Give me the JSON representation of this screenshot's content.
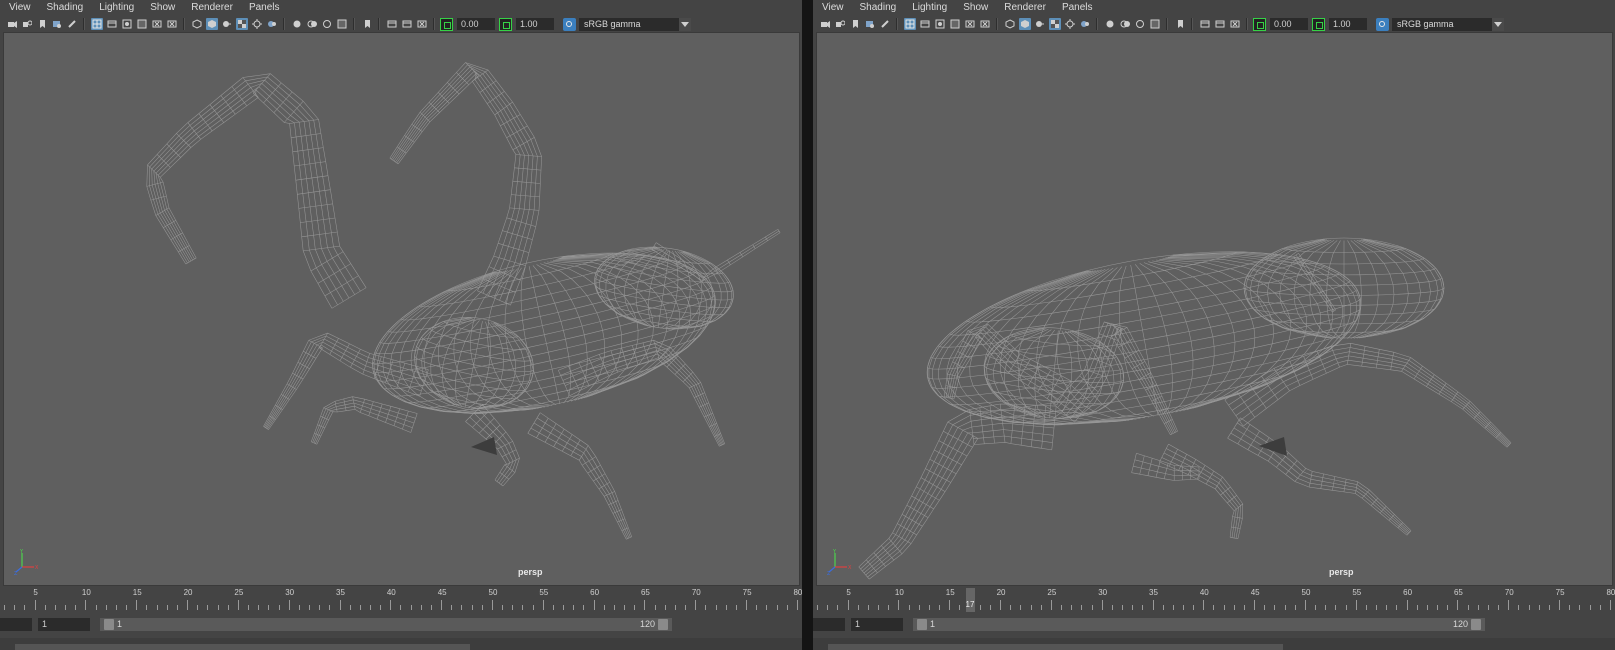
{
  "panels": [
    {
      "id": "left",
      "menu": [
        "View",
        "Shading",
        "Lighting",
        "Show",
        "Renderer",
        "Panels"
      ],
      "toolbar": {
        "exposure": "0.00",
        "gamma": "1.00",
        "color_space": "sRGB gamma"
      },
      "camera": "persp",
      "timeline": {
        "ticks": [
          5,
          10,
          15,
          20,
          25,
          30,
          35,
          40,
          45,
          50,
          55,
          60,
          65,
          70,
          75,
          80
        ],
        "current": null
      },
      "range": {
        "start_field": "1",
        "slider_min": "1",
        "slider_max": "120"
      }
    },
    {
      "id": "right",
      "menu": [
        "View",
        "Shading",
        "Lighting",
        "Show",
        "Renderer",
        "Panels"
      ],
      "toolbar": {
        "exposure": "0.00",
        "gamma": "1.00",
        "color_space": "sRGB gamma"
      },
      "camera": "persp",
      "timeline": {
        "ticks": [
          5,
          10,
          15,
          20,
          25,
          30,
          35,
          40,
          45,
          50,
          55,
          60,
          65,
          70,
          75,
          80
        ],
        "current": "17"
      },
      "range": {
        "start_field": "1",
        "slider_min": "1",
        "slider_max": "120"
      }
    }
  ],
  "icons": [
    "camera-icon",
    "camera-attr-icon",
    "bookmark-icon",
    "image-plane-icon",
    "grease-pencil-icon",
    "grid-icon",
    "film-gate-icon",
    "resolution-gate-icon",
    "safe-action-icon",
    "field-chart-icon",
    "wireframe-icon",
    "smooth-shade-icon",
    "default-light-icon",
    "texture-icon",
    "shadow-icon",
    "ao-icon",
    "isolate-icon",
    "xray-icon",
    "colorspace-icon"
  ],
  "colors": {
    "viewport_bg": "#5f5f5f",
    "wire": "#9c9c9c",
    "accent": "#5d8fb8",
    "gate": "#36d146"
  }
}
